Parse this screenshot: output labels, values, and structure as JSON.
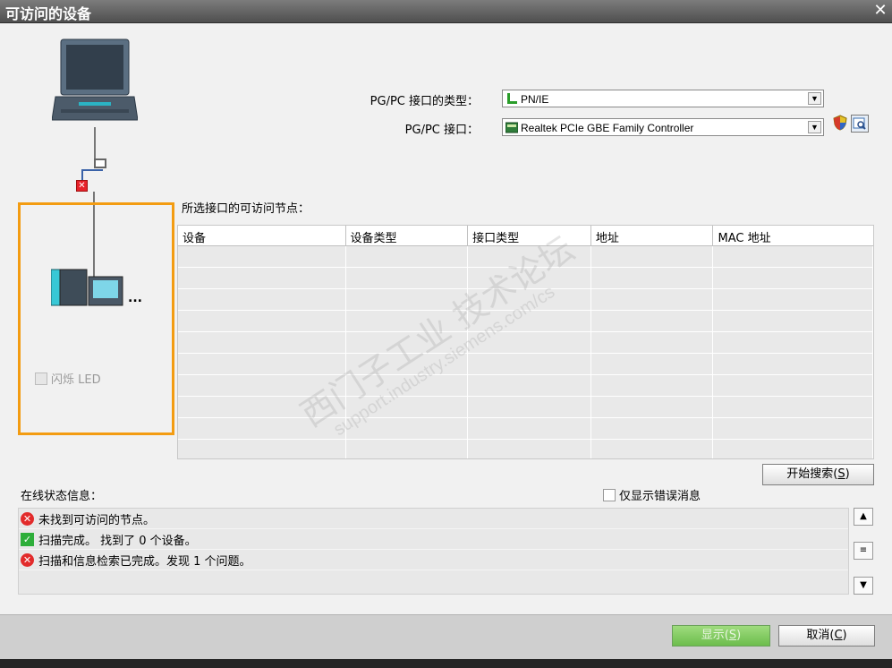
{
  "window": {
    "title": "可访问的设备",
    "close_glyph": "✕"
  },
  "left_panel": {
    "flash_led_label": "闪烁 LED",
    "more_glyph": "..."
  },
  "pgpc_type": {
    "label": "PG/PC 接口的类型：",
    "value": "PN/IE"
  },
  "pgpc_interface": {
    "label": "PG/PC 接口：",
    "value": "Realtek PCIe GBE Family Controller"
  },
  "nodes_section": {
    "label": "所选接口的可访问节点："
  },
  "table": {
    "columns": [
      "设备",
      "设备类型",
      "接口类型",
      "地址",
      "MAC 地址"
    ],
    "row_count": 10
  },
  "watermark": {
    "line1": "西门子工业 技术论坛",
    "line2": "support.industry.siemens.com/cs"
  },
  "search_button": {
    "label": "开始搜索",
    "shortcut": "S"
  },
  "status": {
    "label": "在线状态信息：",
    "errors_only_label": "仅显示错误消息",
    "messages": [
      {
        "type": "error",
        "text": "未找到可访问的节点。"
      },
      {
        "type": "ok",
        "text": "扫描完成。 找到了 0 个设备。"
      },
      {
        "type": "error",
        "text": "扫描和信息检索已完成。发现 1 个问题。"
      }
    ]
  },
  "footer": {
    "show_label": "显示",
    "show_shortcut": "S",
    "cancel_label": "取消",
    "cancel_shortcut": "C"
  },
  "colors": {
    "highlight_border": "#f39c12",
    "error": "#e22b2b",
    "ok": "#2eae3a"
  }
}
